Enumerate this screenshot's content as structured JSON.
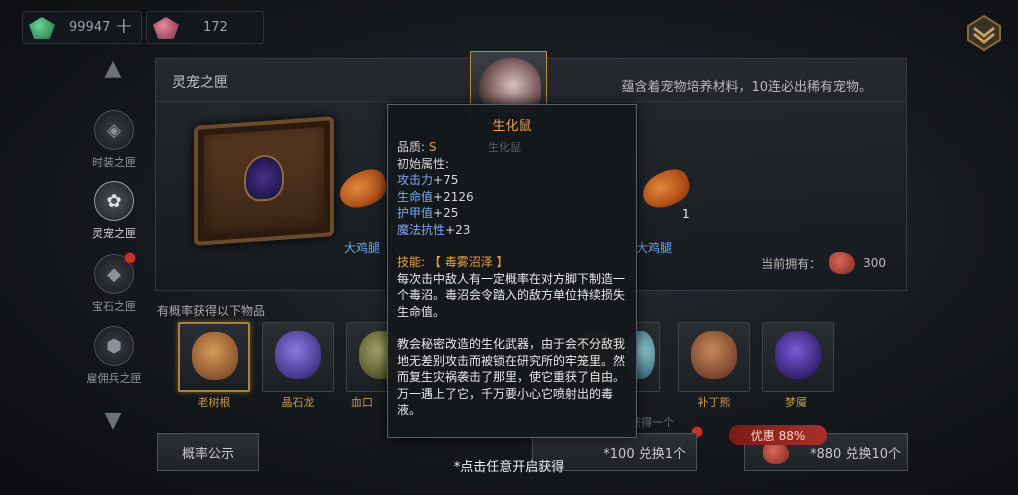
{
  "currency": {
    "jade": {
      "icon": "green-gem-icon",
      "value": "99947",
      "color": "#3aa86a"
    },
    "ruby": {
      "icon": "red-gem-icon",
      "value": "172",
      "color": "#c0566a"
    }
  },
  "nav": {
    "items": [
      {
        "label": "时装之匣",
        "icon": "mask-icon"
      },
      {
        "label": "灵宠之匣",
        "icon": "paw-icon"
      },
      {
        "label": "宝石之匣",
        "icon": "gem-icon"
      },
      {
        "label": "雇佣兵之匣",
        "icon": "mercenary-icon"
      }
    ]
  },
  "panel": {
    "title": "灵宠之匣",
    "description": "蕴含着宠物培养材料，10连必出稀有宠物。",
    "reward_left": {
      "label": "大鸡腿"
    },
    "reward_right": {
      "label": "大鸡腿",
      "count": "1"
    },
    "own": {
      "label": "当前拥有：",
      "value": "300"
    }
  },
  "drops": {
    "title": "有概率获得以下物品",
    "items": [
      {
        "label": "老树根",
        "color": "#b07a3a"
      },
      {
        "label": "晶石龙",
        "color": "#5a4ab0"
      },
      {
        "label": "血口",
        "color": "#6a6a3a"
      },
      {
        "label": "",
        "color": "#4a4a4a"
      },
      {
        "label": "",
        "color": "#4a4a4a"
      },
      {
        "label": "",
        "color": "#6ab0c0"
      },
      {
        "label": "补丁熊",
        "color": "#9a5a3a"
      },
      {
        "label": "梦魇",
        "color": "#3a2a7a"
      }
    ]
  },
  "buttons": {
    "probability": "概率公示",
    "buy_one": "*100 兑换1个",
    "buy_ten": "*880 兑换10个",
    "discount": "优惠 88%",
    "faded_get": "获得一个"
  },
  "hint": "*点击任意开启获得",
  "tooltip": {
    "name": "生化鼠",
    "sub_name": "生化鼠",
    "quality_label": "品质:",
    "quality_value": "S",
    "base_attr": "初始属性:",
    "stats": [
      {
        "name": "攻击力",
        "value": "+75"
      },
      {
        "name": "生命值",
        "value": "+2126"
      },
      {
        "name": "护甲值",
        "value": "+25"
      },
      {
        "name": "魔法抗性",
        "value": "+23"
      }
    ],
    "skill_label": "技能:",
    "skill_name": "【 毒雾沼泽 】",
    "skill_desc": "每次击中敌人有一定概率在对方脚下制造一个毒沼。毒沼会令踏入的敌方单位持续损失生命值。",
    "lore": "教会秘密改造的生化武器，由于会不分敌我地无差别攻击而被锁在研究所的牢笼里。然而复生灾祸袭击了那里，使它重获了自由。万一遇上了它，千万要小心它喷射出的毒液。"
  }
}
